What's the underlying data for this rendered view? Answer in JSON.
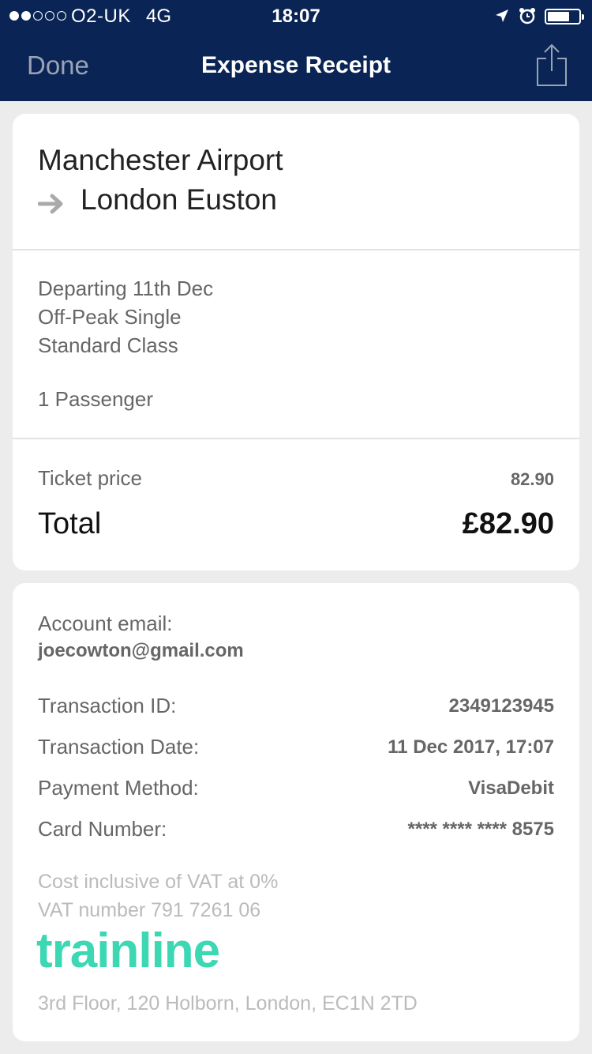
{
  "status_bar": {
    "carrier": "O2-UK",
    "network": "4G",
    "time": "18:07",
    "signal_bars_filled": 2,
    "signal_bars_total": 5,
    "battery_level": 0.7,
    "icons": [
      "location-arrow-icon",
      "alarm-clock-icon",
      "battery-icon"
    ]
  },
  "nav": {
    "done_label": "Done",
    "title": "Expense Receipt",
    "share_icon": "share-icon"
  },
  "journey": {
    "origin": "Manchester Airport",
    "destination": "London Euston",
    "arrow_icon": "arrow-right-icon"
  },
  "ticket": {
    "departing": "Departing 11th Dec",
    "fare_type": "Off-Peak Single",
    "class": "Standard Class",
    "passengers": "1 Passenger"
  },
  "pricing": {
    "ticket_price_label": "Ticket price",
    "ticket_price_value": "82.90",
    "total_label": "Total",
    "total_value": "£82.90"
  },
  "account": {
    "email_label": "Account email:",
    "email_value": "joecowton@gmail.com"
  },
  "transaction": {
    "id_label": "Transaction ID:",
    "id_value": "2349123945",
    "date_label": "Transaction Date:",
    "date_value": "11 Dec 2017, 17:07",
    "method_label": "Payment Method:",
    "method_value": "VisaDebit",
    "card_label": "Card Number:",
    "card_value": "**** **** **** 8575"
  },
  "footer": {
    "vat_note": "Cost inclusive of VAT at 0%",
    "vat_number": "VAT number 791 7261 06",
    "brand": "trainline",
    "address": "3rd Floor, 120 Holborn, London, EC1N 2TD"
  },
  "colors": {
    "header_bg": "#0a2555",
    "brand": "#3cd7b3",
    "page_bg": "#ececec"
  }
}
